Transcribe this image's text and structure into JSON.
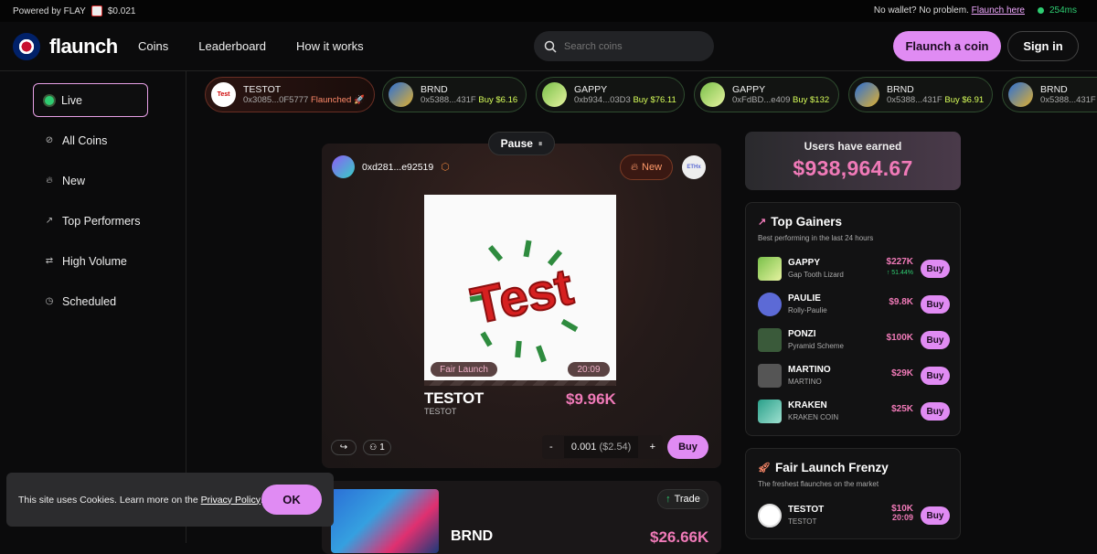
{
  "topbar": {
    "powered": "Powered by FLAY",
    "flay_price": "$0.021",
    "no_wallet": "No wallet? No problem.",
    "flaunch_here": "Flaunch here",
    "ping": "254ms"
  },
  "nav": {
    "brand": "flaunch",
    "links": [
      "Coins",
      "Leaderboard",
      "How it works"
    ],
    "search_placeholder": "Search coins",
    "flaunch_btn": "Flaunch a coin",
    "sign_in": "Sign in"
  },
  "sidebar": {
    "items": [
      "Live",
      "All Coins",
      "New",
      "Top Performers",
      "High Volume",
      "Scheduled"
    ]
  },
  "ticker": [
    {
      "name": "TESTOT",
      "addr": "0x3085...0F5777",
      "action": "Flaunched 🚀"
    },
    {
      "name": "BRND",
      "addr": "0x5388...431F",
      "action": "Buy $6.16"
    },
    {
      "name": "GAPPY",
      "addr": "0xb934...03D3",
      "action": "Buy $76.11"
    },
    {
      "name": "GAPPY",
      "addr": "0xFdBD...e409",
      "action": "Buy $132"
    },
    {
      "name": "BRND",
      "addr": "0x5388...431F",
      "action": "Buy $6.91"
    },
    {
      "name": "BRND",
      "addr": "0x5388...431F",
      "action": ""
    }
  ],
  "feed": {
    "pause": "Pause",
    "creator": "0xd281...e92519",
    "new_badge": "New",
    "chain": "ETHx",
    "img_text": "Test",
    "fair_launch": "Fair Launch",
    "timer": "20:09",
    "coin_name": "TESTOT",
    "coin_symbol": "TESTOT",
    "price": "$9.96K",
    "holders": "1",
    "minus": "-",
    "plus": "+",
    "amount": "0.001",
    "amount_usd": "($2.54)",
    "buy": "Buy",
    "card2_trade": "Trade",
    "card2_name": "BRND",
    "card2_price": "$26.66K"
  },
  "cookie": {
    "text": "This site uses Cookies. Learn more on the",
    "link": "Privacy Policy",
    "dot": ".",
    "ok": "OK"
  },
  "earned": {
    "label": "Users have earned",
    "value": "$938,964.67"
  },
  "gainers": {
    "title": "Top Gainers",
    "subtitle": "Best performing in the last 24 hours",
    "rows": [
      {
        "name": "GAPPY",
        "sub": "Gap Tooth Lizard",
        "price": "$227K",
        "change": "↑ 51.44%",
        "buy": "Buy"
      },
      {
        "name": "PAULIE",
        "sub": "Rolly-Paulie",
        "price": "$9.8K",
        "change": "",
        "buy": "Buy"
      },
      {
        "name": "PONZI",
        "sub": "Pyramid Scheme",
        "price": "$100K",
        "change": "",
        "buy": "Buy"
      },
      {
        "name": "MARTINO",
        "sub": "MARTINO",
        "price": "$29K",
        "change": "",
        "buy": "Buy"
      },
      {
        "name": "KRAKEN",
        "sub": "KRAKEN COIN",
        "price": "$25K",
        "change": "",
        "buy": "Buy"
      }
    ]
  },
  "frenzy": {
    "title": "Fair Launch Frenzy",
    "subtitle": "The freshest flaunches on the market",
    "rows": [
      {
        "name": "TESTOT",
        "sub": "TESTOT",
        "price": "$10K",
        "timer": "20:09",
        "buy": "Buy"
      }
    ]
  },
  "colors": {
    "accent": "#e08bf3",
    "price": "#f07ab8",
    "live": "#2ecc71",
    "buy_text": "#d8ff5a"
  }
}
